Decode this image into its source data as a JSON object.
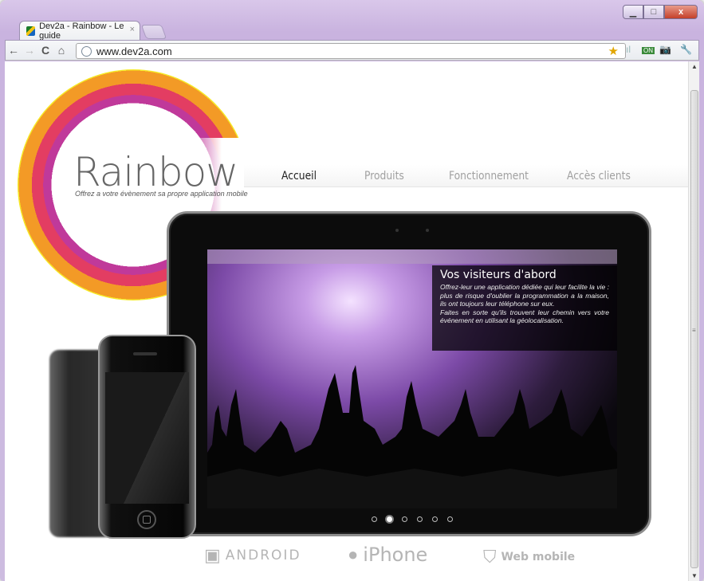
{
  "browser": {
    "tab_title": "Dev2a - Rainbow - Le guide",
    "tab_close": "×",
    "url": "www.dev2a.com",
    "window_controls": {
      "minimize": "▁",
      "maximize": "□",
      "close": "x"
    },
    "nav": {
      "back": "←",
      "forward": "→",
      "reload": "C",
      "home": "⌂"
    },
    "extensions": {
      "star": "★",
      "signal": "ıl",
      "on_badge": "ON",
      "camera": "📷",
      "wrench": "🔧"
    }
  },
  "site": {
    "logo": "Rainbow",
    "tagline": "Offrez a votre évènement sa propre application mobile",
    "menu": [
      {
        "label": "Accueil",
        "active": true
      },
      {
        "label": "Produits",
        "active": false
      },
      {
        "label": "Fonctionnement",
        "active": false
      },
      {
        "label": "Accès clients",
        "active": false
      }
    ],
    "slide": {
      "title": "Vos visiteurs d'abord",
      "paragraph1": "Offrez-leur une application dédiée qui leur facilite la vie : plus de risque d'oublier la programmation a la maison, ils ont toujours leur téléphone sur eux.",
      "paragraph2": "Faites en sorte qu'ils trouvent leur chemin vers votre événement en utilisant la géolocalisation."
    },
    "slider_dots": {
      "count": 6,
      "active_index": 1
    },
    "platforms": [
      {
        "label": "ANDROID",
        "icon": "android-icon"
      },
      {
        "label": "iPhone",
        "icon": "apple-icon"
      },
      {
        "label": "Web mobile",
        "icon": "html5-icon"
      }
    ]
  },
  "colors": {
    "window_frame": "#cdbce0",
    "nav_active": "#222222",
    "nav_inactive": "#a0a0a0"
  }
}
